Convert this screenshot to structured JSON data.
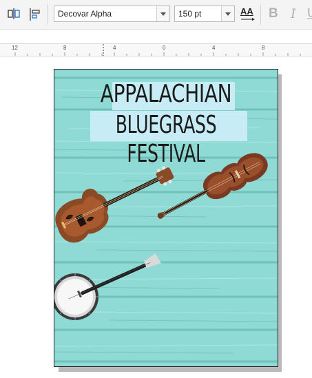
{
  "toolbar": {
    "font_name": "Decovar Alpha",
    "font_size": "150 pt",
    "icons": [
      "text-align-icon",
      "text-frame-icon",
      "font-size-adjust-icon",
      "bold-icon",
      "italic-icon",
      "underline-icon"
    ],
    "bold_label": "B",
    "italic_label": "I",
    "underline_label": "U",
    "size_adjust_label": "AA"
  },
  "ruler": {
    "labels": [
      "12",
      "8",
      "4",
      "0",
      "4",
      "8"
    ]
  },
  "poster": {
    "title_line1": "APPALACHIAN",
    "title_line2": "BLUEGRASS FESTIVAL",
    "background_color": "#8fdad4",
    "title_bg_color": "#c7ecf6",
    "instruments": [
      "mandolin",
      "violin",
      "banjo"
    ]
  }
}
